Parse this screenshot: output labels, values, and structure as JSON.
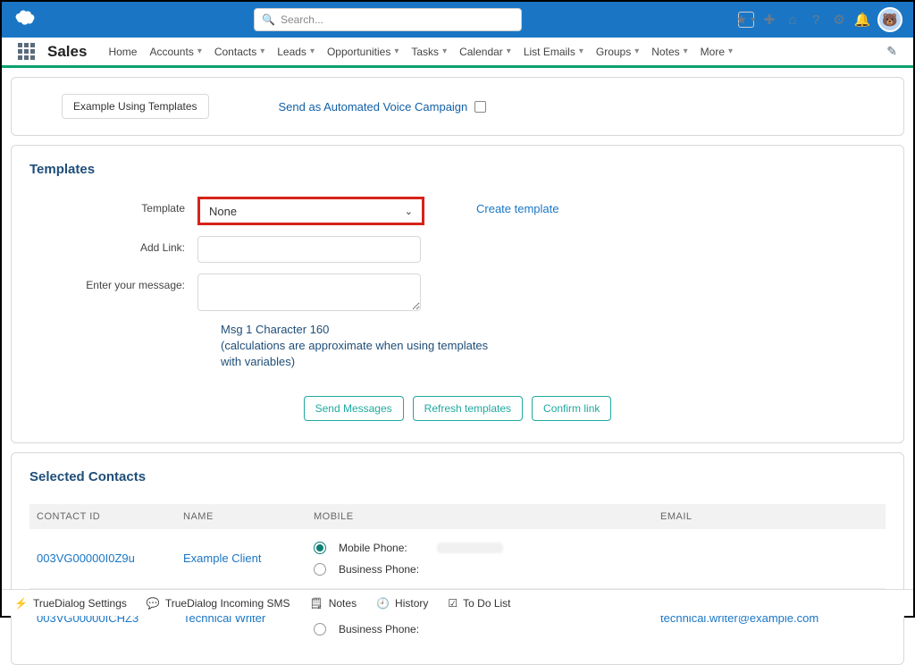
{
  "top": {
    "search_placeholder": "Search..."
  },
  "nav": {
    "app": "Sales",
    "items": [
      "Home",
      "Accounts",
      "Contacts",
      "Leads",
      "Opportunities",
      "Tasks",
      "Calendar",
      "List Emails",
      "Groups",
      "Notes",
      "More"
    ]
  },
  "panel1": {
    "example_btn": "Example Using Templates",
    "campaign_label": "Send as Automated Voice Campaign"
  },
  "templates": {
    "title": "Templates",
    "labels": {
      "template": "Template",
      "add_link": "Add Link:",
      "message": "Enter your message:"
    },
    "template_value": "None",
    "create_link": "Create template",
    "msg_info_line1": "Msg 1 Character 160",
    "msg_info_line2": "(calculations are approximate when using templates with variables)",
    "buttons": {
      "send": "Send Messages",
      "refresh": "Refresh templates",
      "confirm": "Confirm link"
    }
  },
  "contacts": {
    "title": "Selected Contacts",
    "headers": {
      "id": "CONTACT ID",
      "name": "NAME",
      "mobile": "MOBILE",
      "email": "EMAIL"
    },
    "phone_labels": {
      "mobile": "Mobile Phone:",
      "business": "Business Phone:"
    },
    "rows": [
      {
        "id": "003VG00000I0Z9u",
        "name": "Example Client",
        "email": ""
      },
      {
        "id": "003VG00000ICHZ3",
        "name": "Technical Writer",
        "email": "technical.writer@example.com"
      }
    ]
  },
  "footer": {
    "settings": "TrueDialog Settings",
    "incoming": "TrueDialog Incoming SMS",
    "notes": "Notes",
    "history": "History",
    "todo": "To Do List"
  }
}
